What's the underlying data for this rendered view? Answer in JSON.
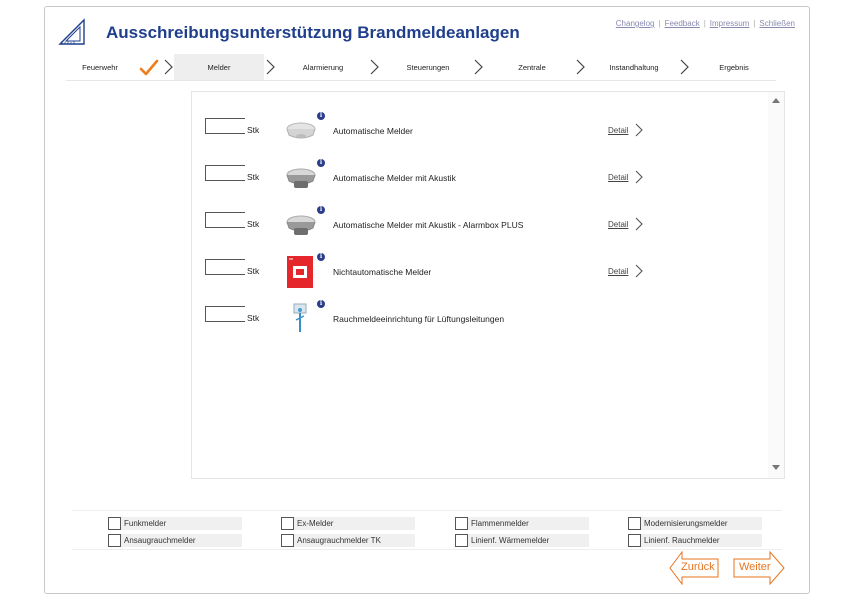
{
  "header": {
    "title": "Ausschreibungsunterstützung Brandmeldeanlagen",
    "links": [
      "Changelog",
      "Feedback",
      "Impressum",
      "Schließen"
    ]
  },
  "steps": [
    {
      "label": "Feuerwehr",
      "state": "done"
    },
    {
      "label": "Melder",
      "state": "active"
    },
    {
      "label": "Alarmierung",
      "state": "pending"
    },
    {
      "label": "Steuerungen",
      "state": "pending"
    },
    {
      "label": "Zentrale",
      "state": "pending"
    },
    {
      "label": "Instandhaltung",
      "state": "pending"
    },
    {
      "label": "Ergebnis",
      "state": "pending"
    }
  ],
  "products": [
    {
      "quantity": "",
      "unit": "Stk",
      "label": "Automatische Melder",
      "icon": "smoke-detector",
      "detail": "Detail"
    },
    {
      "quantity": "",
      "unit": "Stk",
      "label": "Automatische Melder mit Akustik",
      "icon": "smoke-detector-sounder",
      "detail": "Detail"
    },
    {
      "quantity": "",
      "unit": "Stk",
      "label": "Automatische Melder mit Akustik - Alarmbox PLUS",
      "icon": "smoke-detector-sounder",
      "detail": "Detail"
    },
    {
      "quantity": "",
      "unit": "Stk",
      "label": "Nichtautomatische Melder",
      "icon": "manual-call-point",
      "detail": "Detail"
    },
    {
      "quantity": "",
      "unit": "Stk",
      "label": "Rauchmeldeeinrichtung für Lüftungsleitungen",
      "icon": "duct-detector",
      "detail": ""
    }
  ],
  "filters": [
    [
      "Funkmelder",
      "Ex-Melder",
      "Flammenmelder",
      "Modernisierungsmelder"
    ],
    [
      "Ansaugrauchmelder",
      "Ansaugrauchmelder TK",
      "Linienf. Wärmemelder",
      "Linienf. Rauchmelder"
    ]
  ],
  "nav": {
    "back": "Zurück",
    "next": "Weiter"
  },
  "colors": {
    "title": "#1f3f8c",
    "accent": "#e8741e",
    "check": "#f07c1a"
  }
}
